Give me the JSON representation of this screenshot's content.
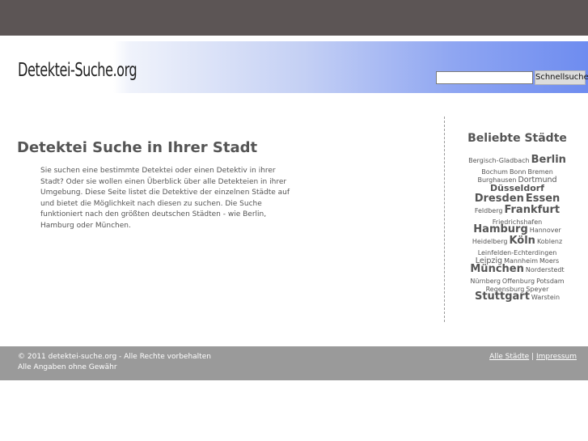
{
  "header": {
    "logo_text": "Detektei-Suche.org",
    "search": {
      "value": "",
      "placeholder": ""
    },
    "search_button_label": "Schnellsuche"
  },
  "main": {
    "title": "Detektei Suche in Ihrer Stadt",
    "intro": "Sie suchen eine bestimmte Detektei oder einen Detektiv in ihrer Stadt? Oder sie wollen einen Überblick über alle Detekteien in ihrer Umgebung. Diese Seite listet die Detektive der einzelnen Städte auf und bietet die Möglichkeit nach diesen zu suchen. Die Suche funktioniert nach den größten deutschen Städten - wie Berlin, Hamburg oder München."
  },
  "sidebar": {
    "title": "Beliebte Städte",
    "tags": [
      {
        "label": "Bergisch-Gladbach",
        "weight": 1
      },
      {
        "label": "Berlin",
        "weight": 4
      },
      {
        "label": "Bochum",
        "weight": 1
      },
      {
        "label": "Bonn",
        "weight": 1
      },
      {
        "label": "Bremen",
        "weight": 1
      },
      {
        "label": "Burghausen",
        "weight": 1
      },
      {
        "label": "Dortmund",
        "weight": 2
      },
      {
        "label": "Düsseldorf",
        "weight": 3
      },
      {
        "label": "Dresden",
        "weight": 4
      },
      {
        "label": "Essen",
        "weight": 4
      },
      {
        "label": "Feldberg",
        "weight": 1
      },
      {
        "label": "Frankfurt",
        "weight": 4
      },
      {
        "label": "Friedrichshafen",
        "weight": 1
      },
      {
        "label": "Hamburg",
        "weight": 4
      },
      {
        "label": "Hannover",
        "weight": 1
      },
      {
        "label": "Heidelberg",
        "weight": 1
      },
      {
        "label": "Köln",
        "weight": 4
      },
      {
        "label": "Koblenz",
        "weight": 1
      },
      {
        "label": "Leinfelden-Echterdingen",
        "weight": 1
      },
      {
        "label": "Leipzig",
        "weight": 2
      },
      {
        "label": "Mannheim",
        "weight": 1
      },
      {
        "label": "Moers",
        "weight": 1
      },
      {
        "label": "München",
        "weight": 4
      },
      {
        "label": "Norderstedt",
        "weight": 1
      },
      {
        "label": "Nürnberg",
        "weight": 1
      },
      {
        "label": "Offenburg",
        "weight": 1
      },
      {
        "label": "Potsdam",
        "weight": 1
      },
      {
        "label": "Regensburg",
        "weight": 1
      },
      {
        "label": "Speyer",
        "weight": 1
      },
      {
        "label": "Stuttgart",
        "weight": 4
      },
      {
        "label": "Warstein",
        "weight": 1
      }
    ],
    "rows": [
      [
        0,
        1
      ],
      [
        2,
        3,
        4
      ],
      [
        5,
        6
      ],
      [
        7
      ],
      [
        8,
        9
      ],
      [
        10,
        11
      ],
      [
        12
      ],
      [
        13,
        14
      ],
      [
        15,
        16,
        17
      ],
      [
        18
      ],
      [
        19,
        20,
        21
      ],
      [
        22,
        23
      ],
      [
        24,
        25,
        26
      ],
      [
        27,
        28
      ],
      [
        29,
        30
      ]
    ]
  },
  "footer": {
    "copyright": "© 2011 detektei-suche.org - Alle Rechte vorbehalten",
    "note": "Alle Angaben ohne Gewähr",
    "link_all_cities": "Alle Städte",
    "separator": "|",
    "link_imprint": "Impressum"
  },
  "colors": {
    "topbar": "#5c5555",
    "footer": "#9a9a9a",
    "header_gradient_end": "#6e8cf0",
    "text": "#555555"
  }
}
